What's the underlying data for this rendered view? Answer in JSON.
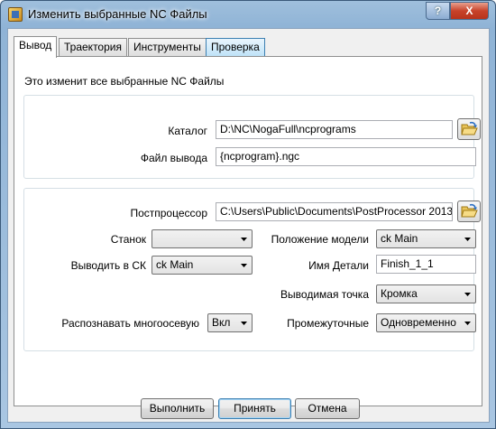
{
  "window": {
    "title": "Изменить выбранные NC Файлы",
    "help_label": "?",
    "close_label": "X"
  },
  "tabs": [
    {
      "label": "Вывод"
    },
    {
      "label": "Траектория"
    },
    {
      "label": "Инструменты"
    },
    {
      "label": "Проверка"
    }
  ],
  "panel": {
    "description": "Это изменит все выбранные NC Файлы",
    "folder": {
      "label": "Каталог",
      "value": "D:\\NC\\NogaFull\\ncprograms"
    },
    "output_file": {
      "label": "Файл вывода",
      "value": "{ncprogram}.ngc"
    },
    "postprocessor": {
      "label": "Постпроцессор",
      "value": "C:\\Users\\Public\\Documents\\PostProcessor 2013"
    },
    "machine": {
      "label": "Станок",
      "value": ""
    },
    "model_location": {
      "label": "Положение модели",
      "value": "ck Main"
    },
    "output_workplane": {
      "label": "Выводить в СК",
      "value": "ck Main"
    },
    "part_name": {
      "label": "Имя Детали",
      "value": "Finish_1_1"
    },
    "output_point": {
      "label": "Выводимая точка",
      "value": "Кромка"
    },
    "multiaxis": {
      "label": "Распознавать многоосевую",
      "value": "Вкл"
    },
    "intermediate": {
      "label": "Промежуточные",
      "value": "Одновременно"
    }
  },
  "buttons": {
    "apply": "Выполнить",
    "accept": "Принять",
    "cancel": "Отмена"
  }
}
